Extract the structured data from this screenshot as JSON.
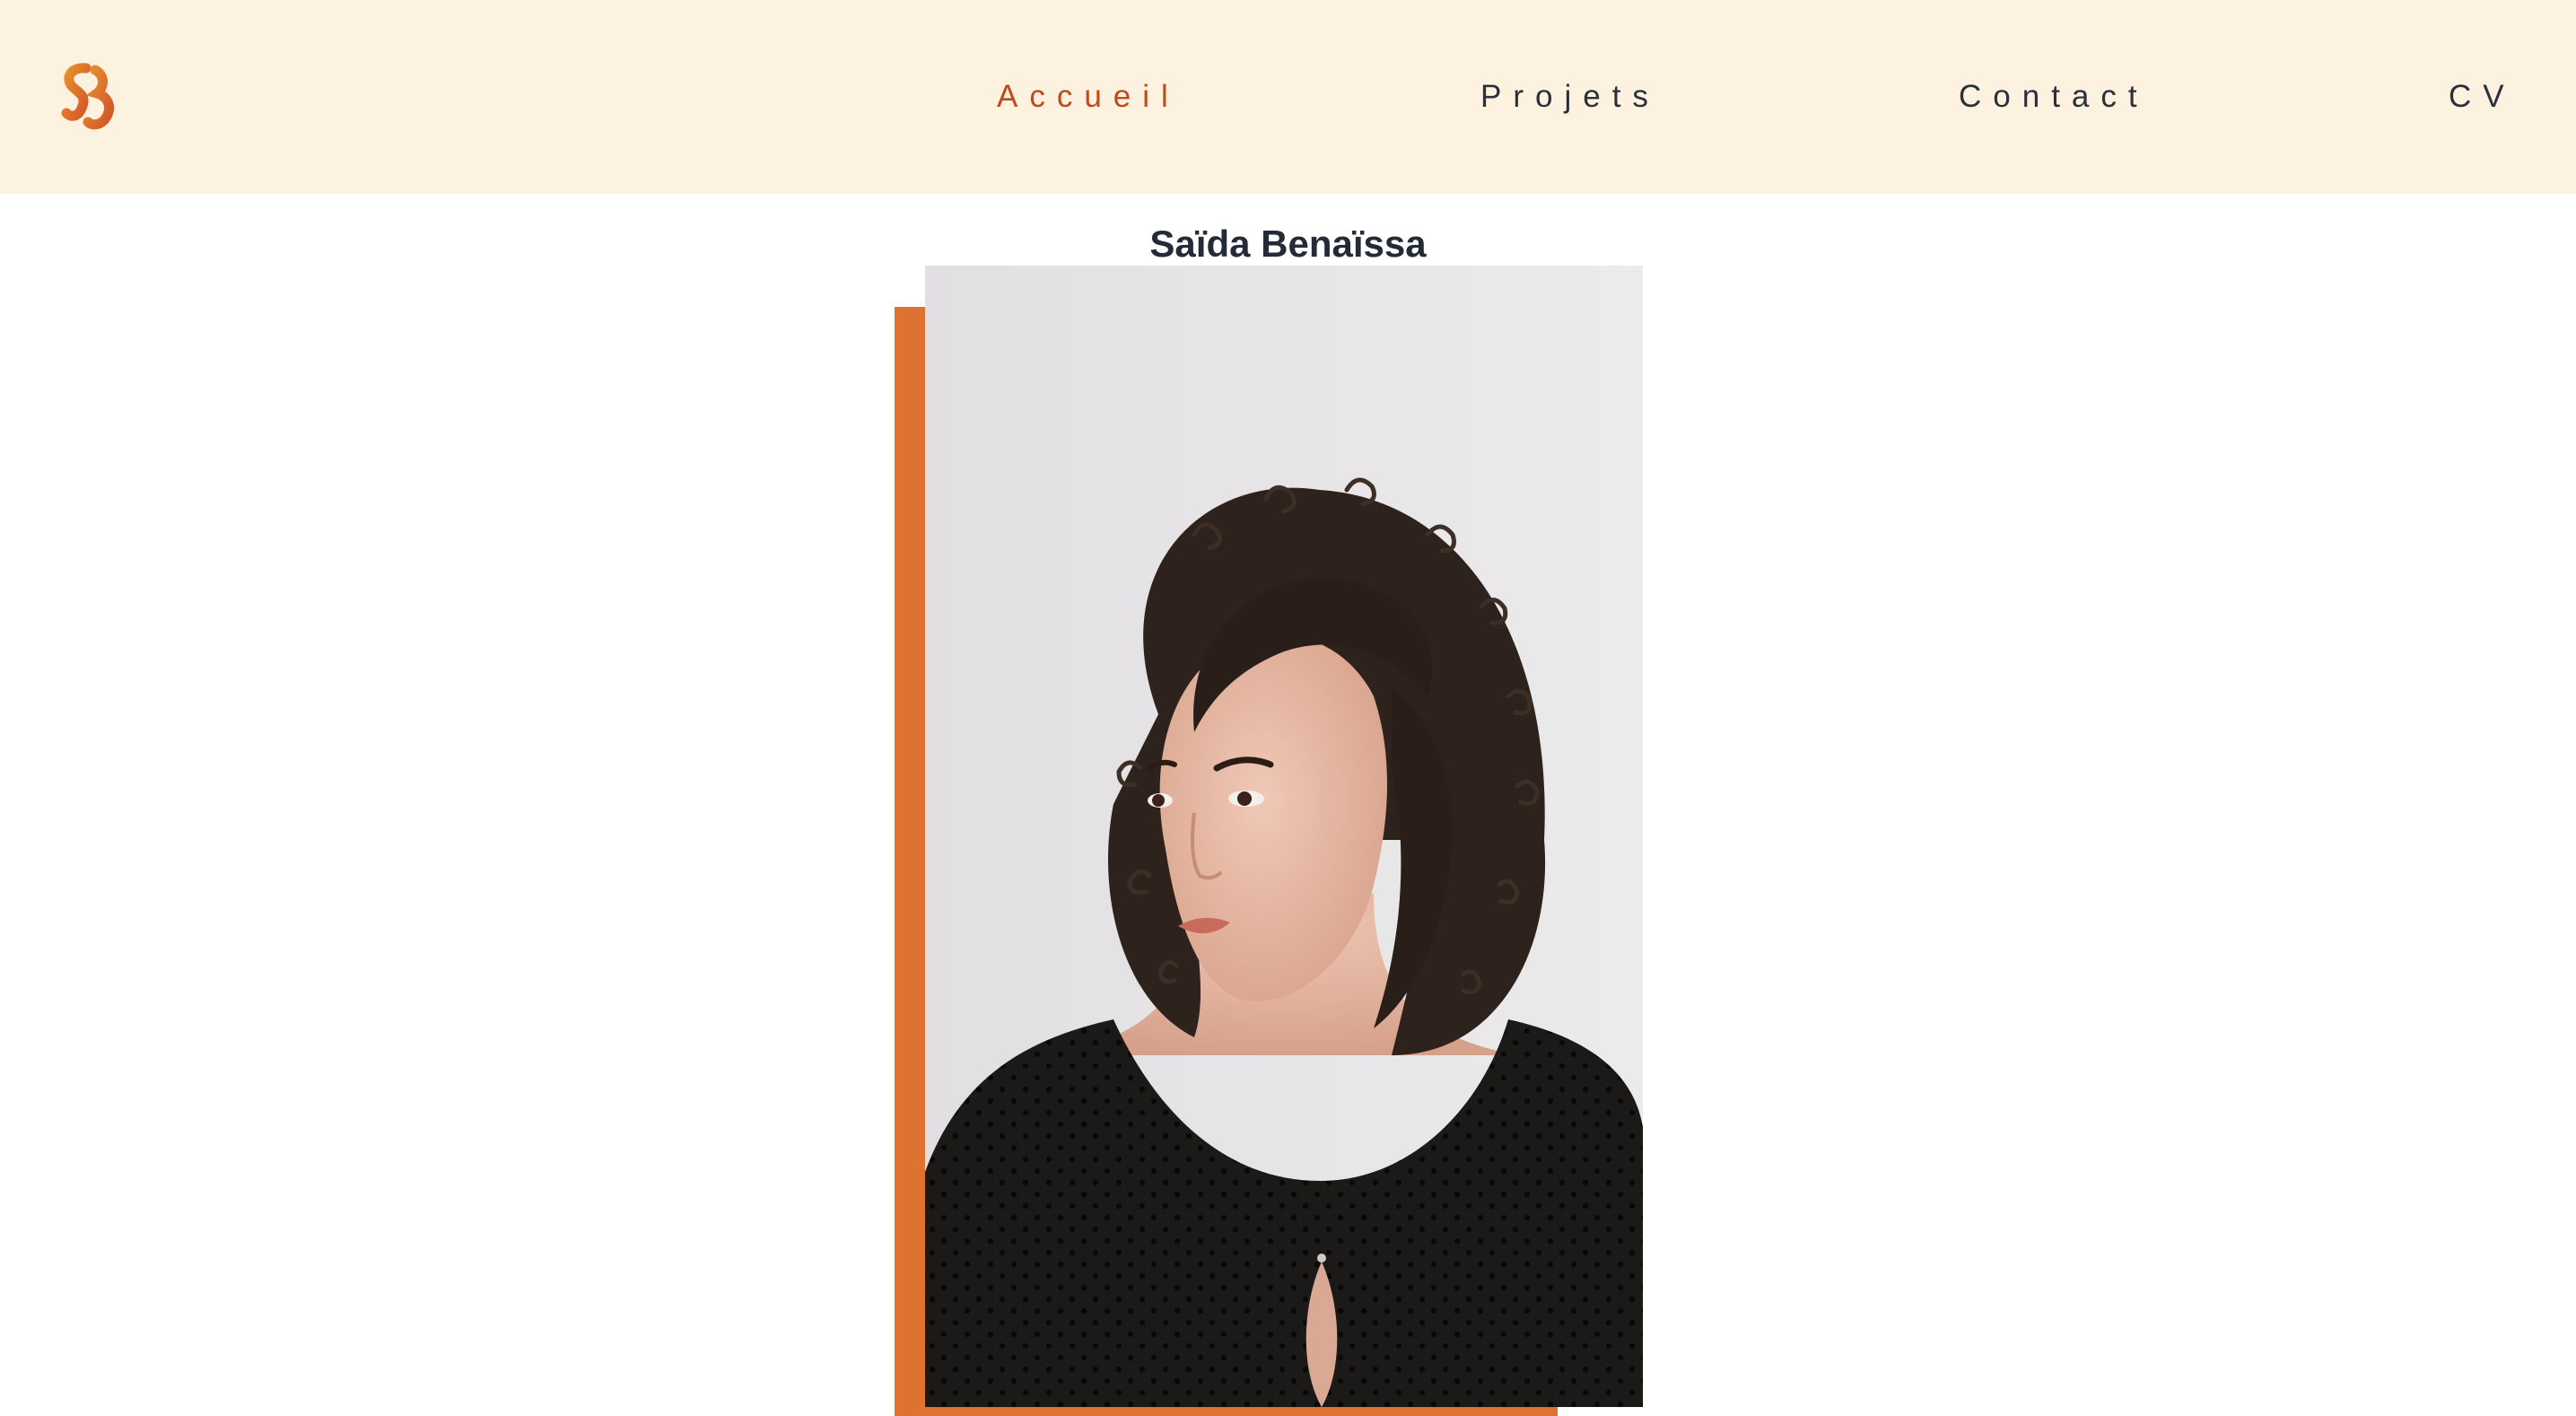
{
  "header": {
    "logo_icon": "sb-monogram-logo-icon",
    "nav": [
      {
        "label": "Accueil",
        "active": true
      },
      {
        "label": "Projets",
        "active": false
      },
      {
        "label": "Contact",
        "active": false
      },
      {
        "label": "CV",
        "active": false
      }
    ]
  },
  "profile": {
    "name": "Saïda Benaïssa"
  },
  "colors": {
    "header_bg": "#fdf1df",
    "accent": "#de7230",
    "active_link": "#bf4a1c",
    "text": "#2b303a"
  }
}
